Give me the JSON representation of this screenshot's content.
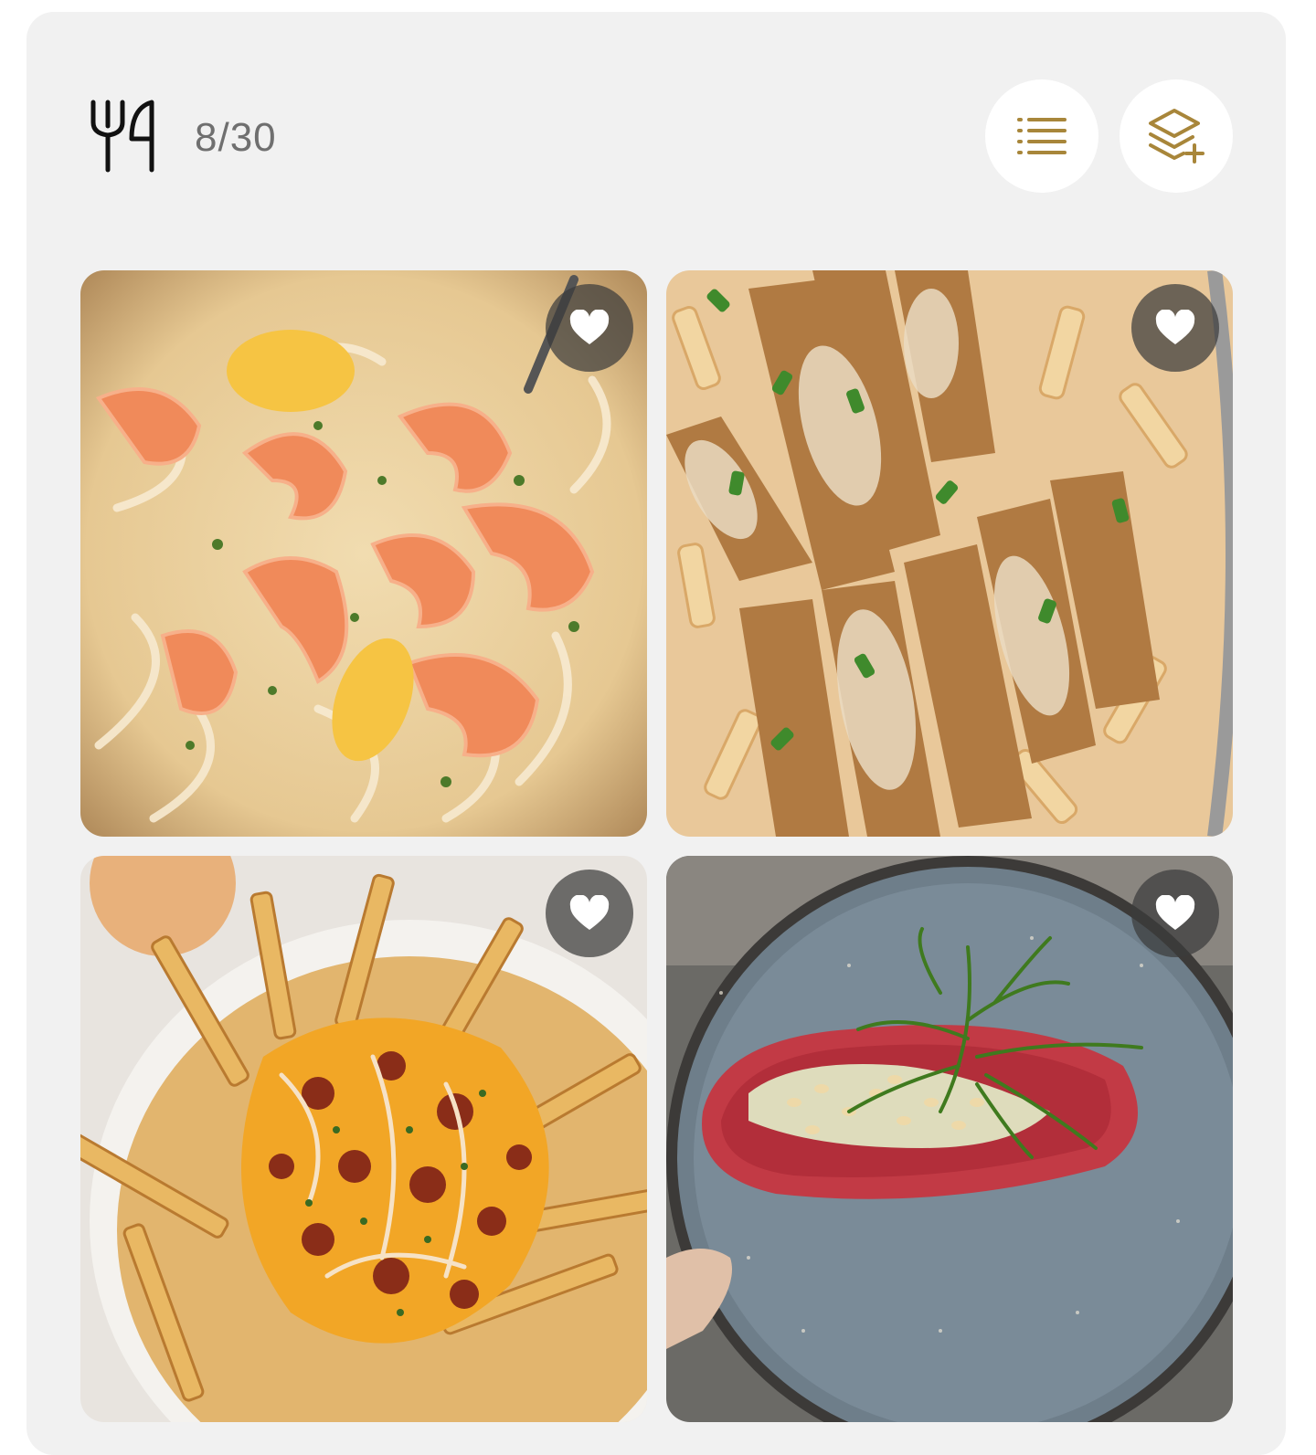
{
  "header": {
    "icon": "fork-knife-icon",
    "counter": "8/30",
    "actions": [
      {
        "name": "list-view-button",
        "icon": "list-icon"
      },
      {
        "name": "add-layer-button",
        "icon": "layers-plus-icon"
      }
    ]
  },
  "colors": {
    "accent": "#a8863a",
    "panel_bg": "#f1f1f1",
    "button_bg": "#ffffff",
    "favorite_bg": "#3c3c3c",
    "counter_text": "#6f6f6f"
  },
  "recipes": [
    {
      "photo": "shrimp-fettuccine-photo",
      "favorite_icon": "heart-icon"
    },
    {
      "photo": "chicken-penne-photo",
      "favorite_icon": "heart-icon"
    },
    {
      "photo": "loaded-fries-photo",
      "favorite_icon": "heart-icon"
    },
    {
      "photo": "tuna-steak-plate-photo",
      "favorite_icon": "heart-icon"
    }
  ]
}
